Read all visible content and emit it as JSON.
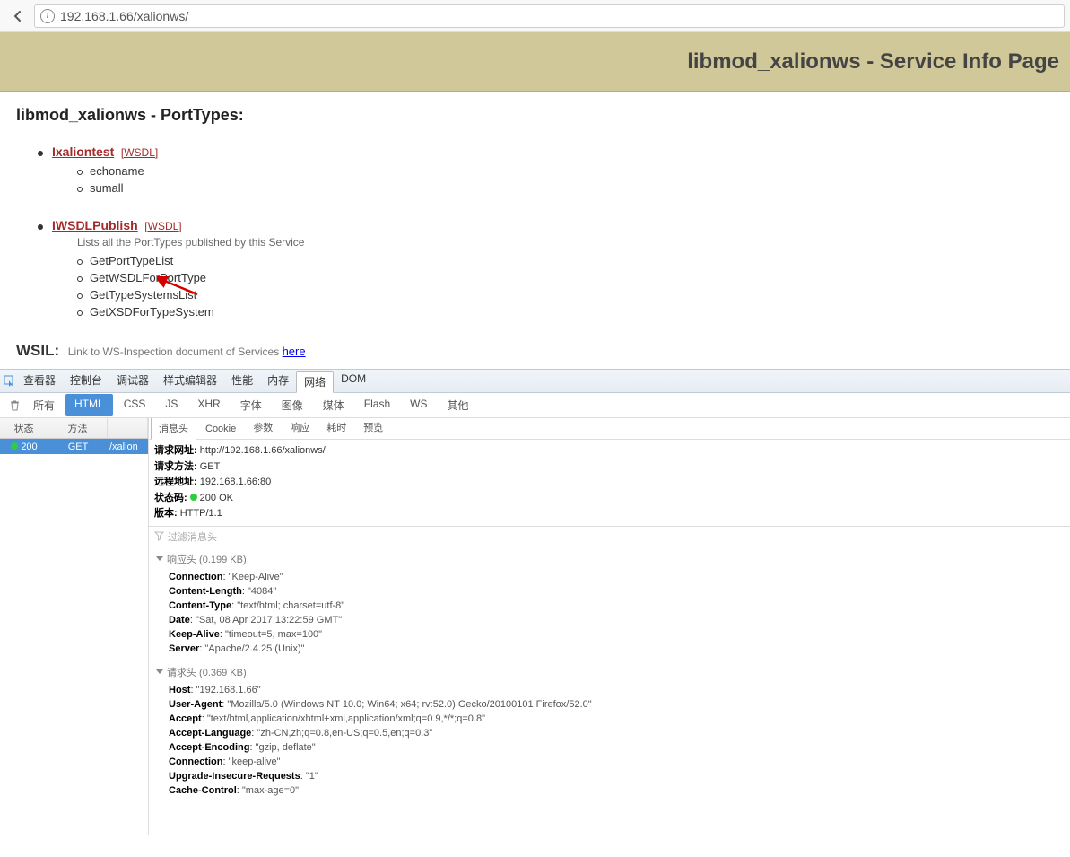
{
  "addressbar": {
    "url": "192.168.1.66/xalionws/"
  },
  "banner": {
    "title": "libmod_xalionws - Service Info Page"
  },
  "page": {
    "heading": "libmod_xalionws - PortTypes:",
    "ports": [
      {
        "name": "Ixaliontest",
        "wsdl": "[WSDL]",
        "desc": "",
        "ops": [
          "echoname",
          "sumall"
        ]
      },
      {
        "name": "IWSDLPublish",
        "wsdl": "[WSDL]",
        "desc": "Lists all the PortTypes published by this Service",
        "ops": [
          "GetPortTypeList",
          "GetWSDLForPortType",
          "GetTypeSystemsList",
          "GetXSDForTypeSystem"
        ]
      }
    ],
    "wsil_label": "WSIL:",
    "wsil_text": "Link to WS-Inspection document of Services ",
    "wsil_link": "here"
  },
  "devtools": {
    "top_tabs": [
      "查看器",
      "控制台",
      "调试器",
      "样式编辑器",
      "性能",
      "内存",
      "网络",
      "DOM"
    ],
    "top_active": "网络",
    "filters": [
      "所有",
      "HTML",
      "CSS",
      "JS",
      "XHR",
      "字体",
      "图像",
      "媒体",
      "Flash",
      "WS",
      "其他"
    ],
    "filter_active": "HTML",
    "reqlist": {
      "cols": [
        "状态",
        "方法",
        ""
      ],
      "c0w": "54px",
      "c1w": "66px",
      "row": {
        "status": "200",
        "method": "GET",
        "file": "/xalion"
      }
    },
    "detail_tabs": [
      "消息头",
      "Cookie",
      "参数",
      "响应",
      "耗时",
      "预览"
    ],
    "detail_active": "消息头",
    "summary": {
      "url_l": "请求网址:",
      "url_v": "http://192.168.1.66/xalionws/",
      "method_l": "请求方法:",
      "method_v": "GET",
      "remote_l": "远程地址:",
      "remote_v": "192.168.1.66:80",
      "status_l": "状态码:",
      "status_v": "200 OK",
      "ver_l": "版本:",
      "ver_v": "HTTP/1.1"
    },
    "filter_placeholder": "过滤消息头",
    "resp_title": "响应头 (0.199 KB)",
    "resp_headers": [
      {
        "k": "Connection",
        "v": "\"Keep-Alive\""
      },
      {
        "k": "Content-Length",
        "v": "\"4084\""
      },
      {
        "k": "Content-Type",
        "v": "\"text/html; charset=utf-8\""
      },
      {
        "k": "Date",
        "v": "\"Sat, 08 Apr 2017 13:22:59 GMT\""
      },
      {
        "k": "Keep-Alive",
        "v": "\"timeout=5, max=100\""
      },
      {
        "k": "Server",
        "v": "\"Apache/2.4.25 (Unix)\""
      }
    ],
    "req_title": "请求头 (0.369 KB)",
    "req_headers": [
      {
        "k": "Host",
        "v": "\"192.168.1.66\""
      },
      {
        "k": "User-Agent",
        "v": "\"Mozilla/5.0 (Windows NT 10.0; Win64; x64; rv:52.0) Gecko/20100101 Firefox/52.0\""
      },
      {
        "k": "Accept",
        "v": "\"text/html,application/xhtml+xml,application/xml;q=0.9,*/*;q=0.8\""
      },
      {
        "k": "Accept-Language",
        "v": "\"zh-CN,zh;q=0.8,en-US;q=0.5,en;q=0.3\""
      },
      {
        "k": "Accept-Encoding",
        "v": "\"gzip, deflate\""
      },
      {
        "k": "Connection",
        "v": "\"keep-alive\""
      },
      {
        "k": "Upgrade-Insecure-Requests",
        "v": "\"1\""
      },
      {
        "k": "Cache-Control",
        "v": "\"max-age=0\""
      }
    ]
  }
}
